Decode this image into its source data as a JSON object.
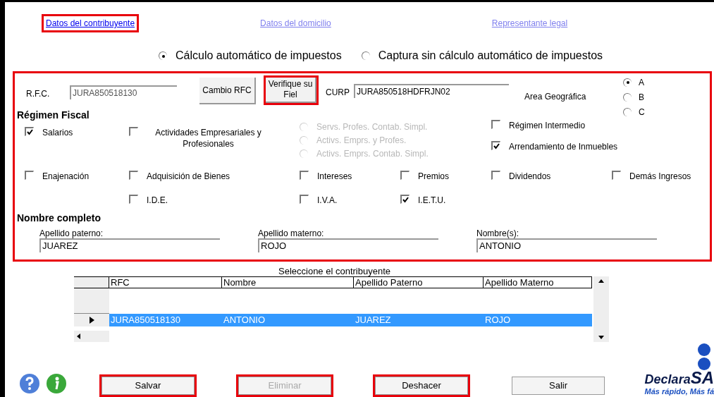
{
  "tabs": [
    {
      "label": "Datos del contribuyente",
      "selected": true,
      "highlighted": true
    },
    {
      "label": "Datos del domicilio",
      "selected": false,
      "highlighted": false
    },
    {
      "label": "Representante legal",
      "selected": false,
      "highlighted": false
    }
  ],
  "calc_mode": [
    {
      "label": "Cálculo automático de impuestos",
      "selected": true
    },
    {
      "label": "Captura sin cálculo automático de impuestos",
      "selected": false
    }
  ],
  "rfc": {
    "label": "R.F.C.",
    "value": "JURA850518130",
    "disabled": true
  },
  "cambio_rfc_button": {
    "label": "Cambio RFC",
    "highlighted": false
  },
  "verifique_button": {
    "label": "Verifique su Fiel",
    "highlighted": true
  },
  "curp": {
    "label": "CURP",
    "value": "JURA850518HDFRJN02"
  },
  "area_geografica": {
    "label": "Area Geográfica",
    "options": [
      {
        "label": "A",
        "selected": true
      },
      {
        "label": "B",
        "selected": false
      },
      {
        "label": "C",
        "selected": false
      }
    ]
  },
  "regimen_fiscal": {
    "title": "Régimen Fiscal",
    "rows": [
      [
        {
          "kind": "checkbox",
          "label": "Salarios",
          "checked": true,
          "disabled": false
        },
        {
          "kind": "checkbox",
          "label": "Actividades Empresariales y Profesionales",
          "checked": false,
          "disabled": false
        },
        {
          "kind": "radio_group",
          "options": [
            {
              "label": "Servs. Profes. Contab. Simpl.",
              "selected": false,
              "disabled": true
            },
            {
              "label": "Activs. Emprs. y Profes.",
              "selected": false,
              "disabled": true
            },
            {
              "label": "Activs. Emprs. Contab. Simpl.",
              "selected": false,
              "disabled": true
            }
          ]
        },
        {
          "kind": "empty"
        },
        {
          "kind": "checkbox_stack",
          "items": [
            {
              "label": "Régimen Intermedio",
              "checked": false,
              "disabled": false
            },
            {
              "label": "Arrendamiento de Inmuebles",
              "checked": true,
              "disabled": false
            }
          ]
        }
      ],
      [
        {
          "kind": "checkbox",
          "label": "Enajenación",
          "checked": false,
          "disabled": false
        },
        {
          "kind": "checkbox",
          "label": "Adquisición de Bienes",
          "checked": false,
          "disabled": false
        },
        {
          "kind": "checkbox",
          "label": "Intereses",
          "checked": false,
          "disabled": false
        },
        {
          "kind": "checkbox",
          "label": "Premios",
          "checked": false,
          "disabled": false
        },
        {
          "kind": "checkbox",
          "label": "Dividendos",
          "checked": false,
          "disabled": false
        },
        {
          "kind": "checkbox",
          "label": "Demás Ingresos",
          "checked": false,
          "disabled": false
        }
      ],
      [
        {
          "kind": "empty"
        },
        {
          "kind": "checkbox",
          "label": "I.D.E.",
          "checked": false,
          "disabled": false
        },
        {
          "kind": "checkbox",
          "label": "I.V.A.",
          "checked": false,
          "disabled": false
        },
        {
          "kind": "checkbox",
          "label": "I.E.T.U.",
          "checked": true,
          "disabled": false
        }
      ]
    ]
  },
  "nombre_completo": {
    "title": "Nombre completo",
    "fields": [
      {
        "label": "Apellido paterno:",
        "value": "JUAREZ"
      },
      {
        "label": "Apellido materno:",
        "value": "ROJO"
      },
      {
        "label": "Nombre(s):",
        "value": "ANTONIO"
      }
    ]
  },
  "contribuyentes": {
    "caption": "Seleccione el contribuyente",
    "columns": [
      "RFC",
      "Nombre",
      "Apellido Paterno",
      "Apellido Materno"
    ],
    "rows": [
      {
        "cells": [
          "JURA850518130",
          "ANTONIO",
          "JUAREZ",
          "ROJO"
        ],
        "selected": true
      }
    ]
  },
  "buttons": [
    {
      "label": "Salvar",
      "disabled": false,
      "highlighted": true
    },
    {
      "label": "Eliminar",
      "disabled": true,
      "highlighted": true
    },
    {
      "label": "Deshacer",
      "disabled": false,
      "highlighted": true
    },
    {
      "label": "Salir",
      "disabled": false,
      "highlighted": false
    }
  ],
  "logo": {
    "name_start": "Declara",
    "name_end": "SA",
    "tagline": "Más rápido, Más fá"
  }
}
